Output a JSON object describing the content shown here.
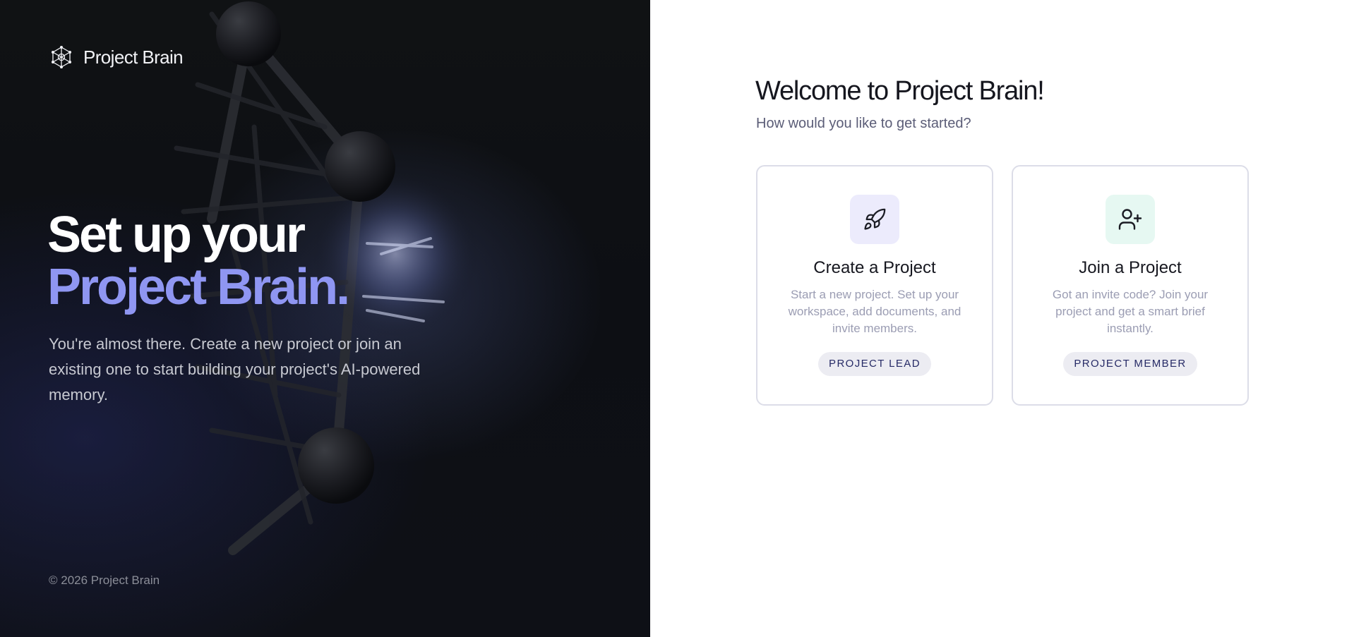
{
  "brand": {
    "name": "Project Brain",
    "logo_icon": "brain-network-icon"
  },
  "hero": {
    "heading_line1": "Set up your",
    "heading_line2": "Project Brain.",
    "description": "You're almost there. Create a new project or join an existing one to start building your project's AI-powered memory.",
    "footer": "© 2026 Project Brain",
    "accent_color": "#8f96f2"
  },
  "welcome": {
    "title": "Welcome to Project Brain!",
    "subtitle": "How would you like to get started?"
  },
  "options": [
    {
      "icon": "rocket-icon",
      "title": "Create a Project",
      "description": "Start a new project. Set up your workspace, add documents, and invite members.",
      "badge": "PROJECT LEAD"
    },
    {
      "icon": "user-plus-icon",
      "title": "Join a Project",
      "description": "Got an invite code? Join your project and get a smart brief instantly.",
      "badge": "PROJECT MEMBER"
    }
  ]
}
